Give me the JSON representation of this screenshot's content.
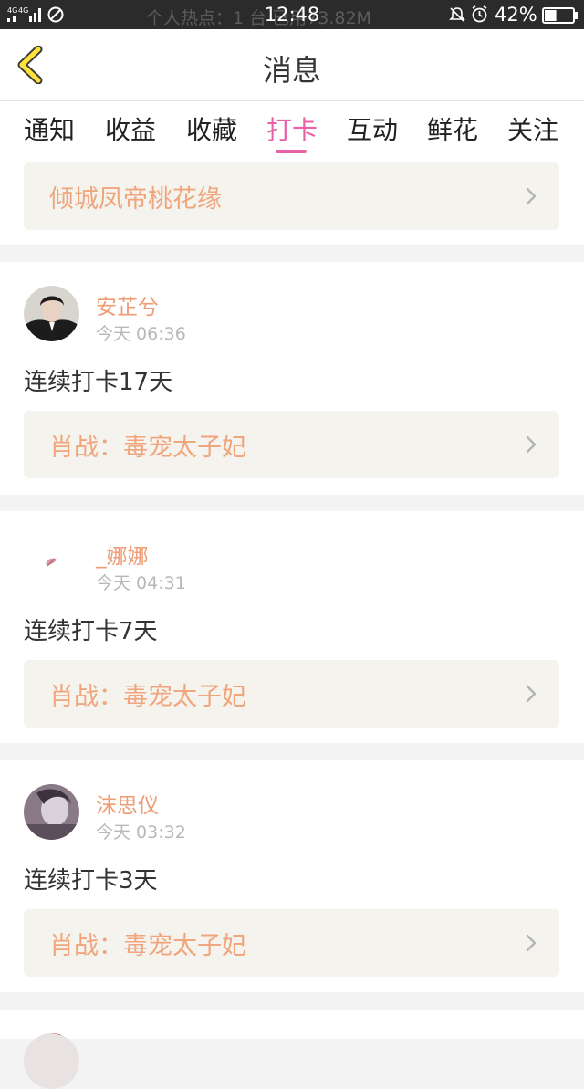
{
  "status_bar": {
    "network": "4G 4G",
    "marquee": "个人热点：1 台   已用73.82M",
    "time": "12:48",
    "battery_percent": "42%",
    "battery_level": 0.42
  },
  "header": {
    "title": "消息"
  },
  "tabs": [
    {
      "label": "通知",
      "active": false
    },
    {
      "label": "收益",
      "active": false
    },
    {
      "label": "收藏",
      "active": false
    },
    {
      "label": "打卡",
      "active": true
    },
    {
      "label": "互动",
      "active": false
    },
    {
      "label": "鲜花",
      "active": false
    },
    {
      "label": "关注",
      "active": false
    }
  ],
  "top_book": {
    "title": "倾城凤帝桃花缘"
  },
  "entries": [
    {
      "user": "安芷兮",
      "time": "今天 06:36",
      "message": "连续打卡17天",
      "book": "肖战：毒宠太子妃"
    },
    {
      "user": "_娜娜",
      "time": "今天 04:31",
      "message": "连续打卡7天",
      "book": "肖战：毒宠太子妃"
    },
    {
      "user": "沫思仪",
      "time": "今天 03:32",
      "message": "连续打卡3天",
      "book": "肖战：毒宠太子妃"
    }
  ],
  "colors": {
    "accent": "#e860a6",
    "username": "#ef9b74",
    "book_title": "#f0a57c",
    "book_box": "#f4f3ee"
  }
}
